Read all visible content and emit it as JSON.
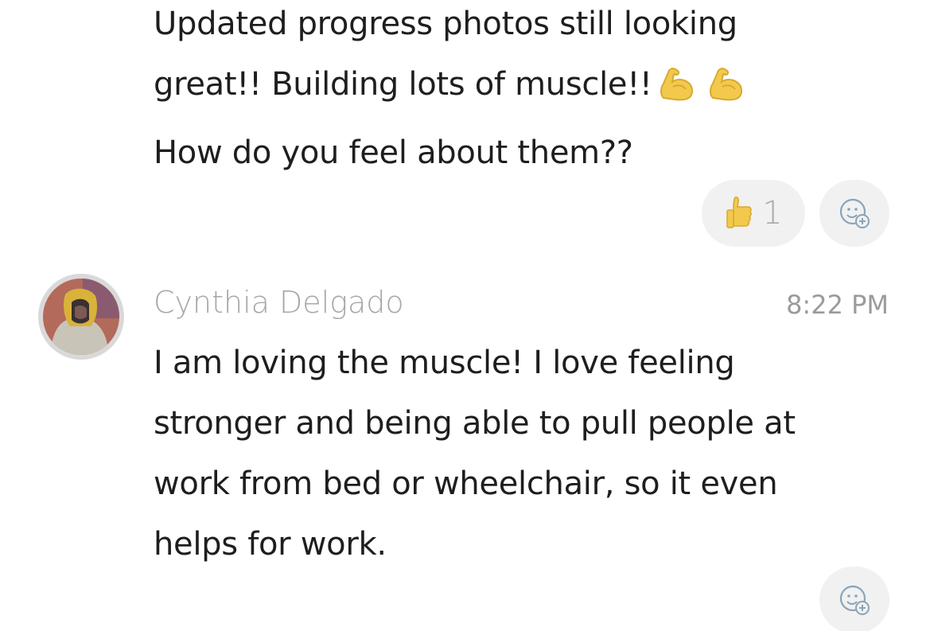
{
  "message_1": {
    "lines": [
      "Updated progress photos still looking",
      "great!! Building lots of muscle!!",
      "How do you feel about them??"
    ],
    "emojis": [
      "flexed-biceps-icon",
      "flexed-biceps-icon"
    ],
    "reactions": [
      {
        "icon": "thumbs-up-icon",
        "count": "1"
      }
    ],
    "add_reaction_icon": "add-reaction-icon"
  },
  "message_2": {
    "sender": "Cynthia Delgado",
    "time": "8:22 PM",
    "lines": [
      "I am loving the muscle! I love feeling",
      "stronger and being able to pull people at",
      "work from bed or wheelchair, so it even",
      "helps for work."
    ],
    "add_reaction_icon": "add-reaction-icon"
  },
  "colors": {
    "text": "#1e1e1e",
    "muted": "#a7a7a7",
    "pill_bg": "#f1f1f1",
    "emoji_yellow": "#f2c94c"
  }
}
